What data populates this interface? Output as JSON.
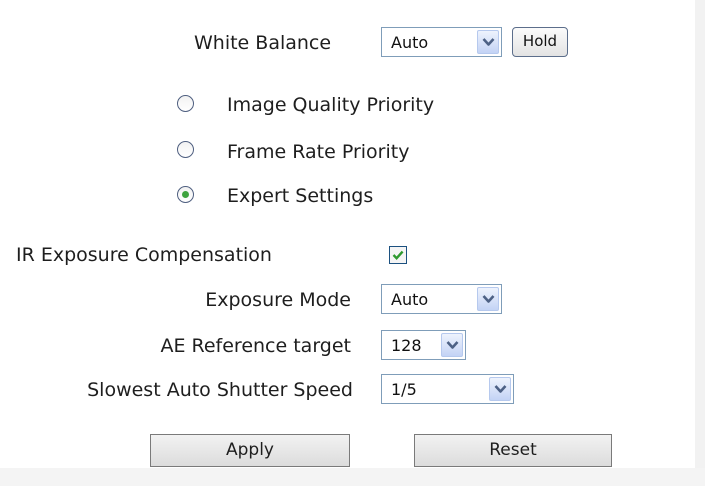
{
  "white_balance": {
    "label": "White Balance",
    "value": "Auto",
    "hold_label": "Hold"
  },
  "priority_modes": [
    {
      "label": "Image Quality Priority",
      "checked": false
    },
    {
      "label": "Frame Rate Priority",
      "checked": false
    },
    {
      "label": "Expert Settings",
      "checked": true
    }
  ],
  "ir_exposure_compensation": {
    "label": "IR Exposure Compensation",
    "checked": true
  },
  "exposure_mode": {
    "label": "Exposure Mode",
    "value": "Auto"
  },
  "ae_reference_target": {
    "label": "AE Reference target",
    "value": "128"
  },
  "slowest_auto_shutter_speed": {
    "label": "Slowest Auto Shutter Speed",
    "value": "1/5"
  },
  "buttons": {
    "apply": "Apply",
    "reset": "Reset"
  },
  "colors": {
    "radio_dot": "#3ea33e",
    "checkmark": "#2f9a2f",
    "select_border": "#7f9db9"
  }
}
